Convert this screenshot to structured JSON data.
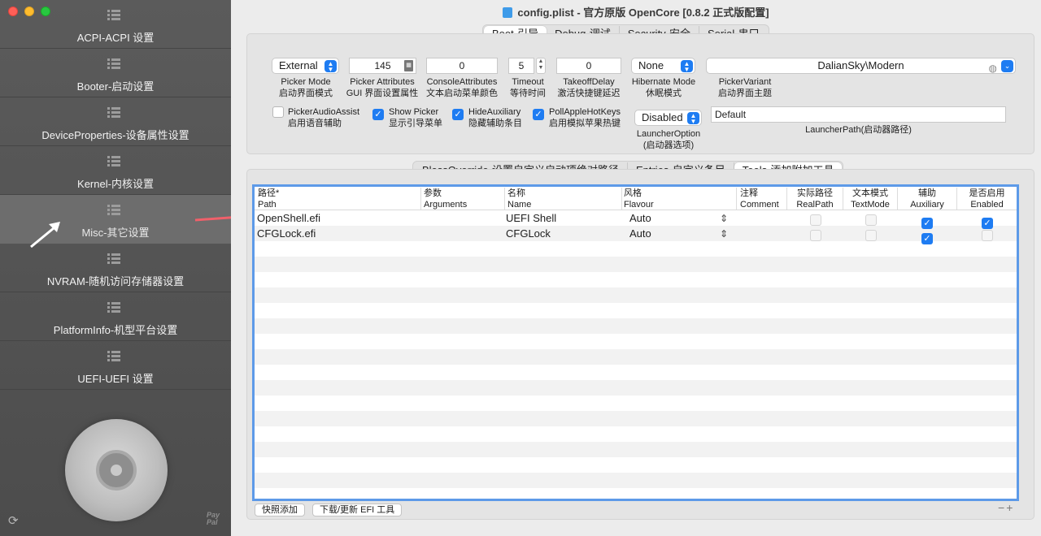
{
  "window": {
    "title": "config.plist - 官方原版 OpenCore [0.8.2 正式版配置]"
  },
  "sidebar": {
    "items": [
      {
        "label": "ACPI-ACPI 设置"
      },
      {
        "label": "Booter-启动设置"
      },
      {
        "label": "DeviceProperties-设备属性设置"
      },
      {
        "label": "Kernel-内核设置"
      },
      {
        "label": "Misc-其它设置",
        "active": true
      },
      {
        "label": "NVRAM-随机访问存储器设置"
      },
      {
        "label": "PlatformInfo-机型平台设置"
      },
      {
        "label": "UEFI-UEFI 设置"
      }
    ],
    "paypal_text": "Pay Pal"
  },
  "top_tabs": [
    "Boot-引导",
    "Debug-调试",
    "Security-安全",
    "Serial-串口"
  ],
  "boot": {
    "picker_mode": {
      "value": "External",
      "label1": "Picker Mode",
      "label2": "启动界面模式"
    },
    "picker_attributes": {
      "value": "145",
      "label1": "Picker Attributes",
      "label2": "GUI 界面设置属性"
    },
    "console_attributes": {
      "value": "0",
      "label1": "ConsoleAttributes",
      "label2": "文本启动菜单颜色"
    },
    "timeout": {
      "value": "5",
      "label1": "Timeout",
      "label2": "等待时间"
    },
    "takeoff_delay": {
      "value": "0",
      "label1": "TakeoffDelay",
      "label2": "激活快捷键延迟"
    },
    "hibernate_mode": {
      "value": "None",
      "label1": "Hibernate Mode",
      "label2": "休眠模式"
    },
    "picker_variant": {
      "value": "DalianSky\\Modern",
      "label1": "PickerVariant",
      "label2": "启动界面主题"
    },
    "checkboxes": [
      {
        "label1": "PickerAudioAssist",
        "label2": "启用语音辅助",
        "checked": false
      },
      {
        "label1": "Show Picker",
        "label2": "显示引导菜单",
        "checked": true
      },
      {
        "label1": "HideAuxiliary",
        "label2": "隐藏辅助条目",
        "checked": true
      },
      {
        "label1": "PollAppleHotKeys",
        "label2": "启用模拟苹果热键",
        "checked": true
      }
    ],
    "launcher_option": {
      "value": "Disabled",
      "label1": "LauncherOption",
      "label2": "(启动器选项)"
    },
    "launcher_path": {
      "value": "Default",
      "label": "LauncherPath(启动器路径)"
    }
  },
  "sub_tabs": [
    "BlessOverride-设置自定义启动项绝对路径",
    "Entries-自定义条目",
    "Tools-添加附加工具"
  ],
  "table": {
    "headers": [
      {
        "zh": "路径*",
        "en": "Path"
      },
      {
        "zh": "参数",
        "en": "Arguments"
      },
      {
        "zh": "名称",
        "en": "Name"
      },
      {
        "zh": "风格",
        "en": "Flavour"
      },
      {
        "zh": "注释",
        "en": "Comment"
      },
      {
        "zh": "实际路径",
        "en": "RealPath"
      },
      {
        "zh": "文本模式",
        "en": "TextMode"
      },
      {
        "zh": "辅助",
        "en": "Auxiliary"
      },
      {
        "zh": "是否启用",
        "en": "Enabled"
      }
    ],
    "rows": [
      {
        "path": "OpenShell.efi",
        "arguments": "",
        "name": "UEFI Shell",
        "flavour": "Auto",
        "comment": "",
        "realpath": false,
        "textmode": false,
        "auxiliary": true,
        "enabled": true
      },
      {
        "path": "CFGLock.efi",
        "arguments": "",
        "name": "CFGLock",
        "flavour": "Auto",
        "comment": "",
        "realpath": false,
        "textmode": false,
        "auxiliary": true,
        "enabled": false
      }
    ]
  },
  "bottom": {
    "snapshot_add": "快照添加",
    "download_update": "下载/更新 EFI 工具"
  },
  "colors": {
    "accent": "#1e7cf2",
    "table_border": "#5d9ae8",
    "sidebar_bg": "#555555",
    "arrow": "#f0606a"
  }
}
